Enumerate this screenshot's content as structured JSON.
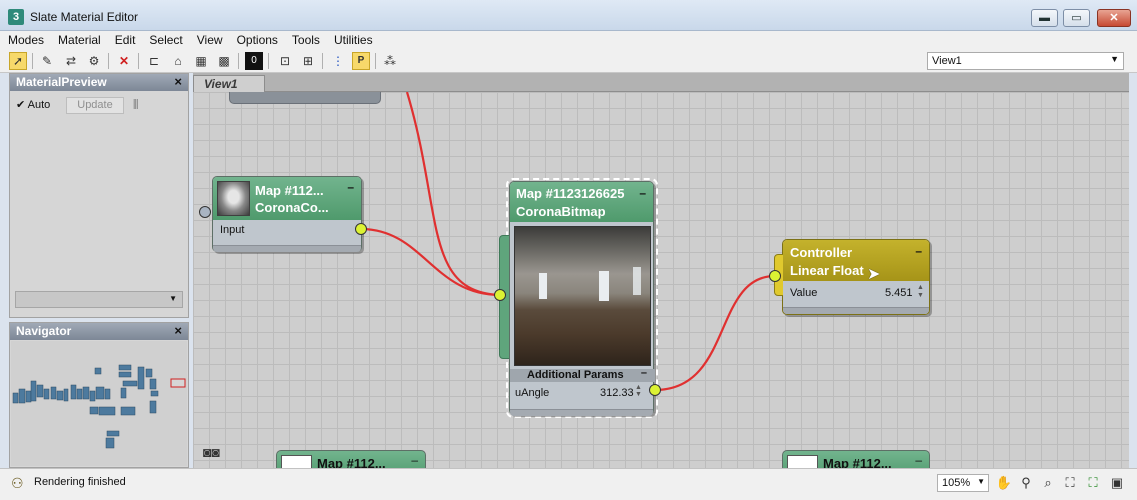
{
  "window": {
    "title": "Slate Material Editor",
    "app_icon": "3",
    "minimize": "▬",
    "maximize": "▭",
    "close": "✕"
  },
  "menu": [
    "Modes",
    "Material",
    "Edit",
    "Select",
    "View",
    "Options",
    "Tools",
    "Utilities"
  ],
  "toolbar": {
    "view_select": "View1",
    "icons": [
      "pick-pointer-icon",
      "pick-material-icon",
      "put-to-scene-icon",
      "assign-to-selection-icon",
      "delete-icon",
      "move-children-icon",
      "hide-unused-slots-icon",
      "checker-background-icon",
      "background-icon",
      "show-map-in-viewport-icon",
      "layout-all-icon",
      "layout-children-icon",
      "material-map-navigator-icon",
      "parameter-editor-icon",
      "select-by-material-icon"
    ]
  },
  "material_preview": {
    "title": "MaterialPreview",
    "close": "×",
    "auto_label": "Auto",
    "auto_checked": true,
    "update_label": "Update"
  },
  "navigator": {
    "title": "Navigator",
    "close": "×"
  },
  "view_tab": "View1",
  "nodes": {
    "map_a": {
      "line1": "Map #112...",
      "line2": "CoronaCo...",
      "input_label": "Input",
      "collapse": "–"
    },
    "bitmap": {
      "line1": "Map #1123126625",
      "line2": "CoronaBitmap",
      "params_label": "Additional Params",
      "param_name": "uAngle",
      "param_value": "312.33",
      "collapse": "–"
    },
    "controller": {
      "line1": "Controller",
      "line2": "Linear Float",
      "param_name": "Value",
      "param_value": "5.451",
      "collapse": "–",
      "color": "#b9a825"
    },
    "bottom_left": {
      "label": "Map #112...",
      "collapse": "–"
    },
    "bottom_right": {
      "label": "Map #112...",
      "collapse": "–"
    }
  },
  "wire_color": "#e03030",
  "status": {
    "text": "Rendering finished",
    "zoom": "105%"
  }
}
